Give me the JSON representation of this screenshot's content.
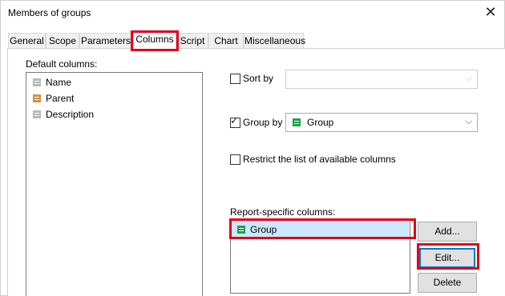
{
  "window": {
    "title": "Members of groups",
    "close_glyph": "✕"
  },
  "tabs": [
    {
      "label": "General"
    },
    {
      "label": "Scope"
    },
    {
      "label": "Parameters"
    },
    {
      "label": "Columns",
      "active": true
    },
    {
      "label": "Script"
    },
    {
      "label": "Chart"
    },
    {
      "label": "Miscellaneous"
    }
  ],
  "default_columns": {
    "label": "Default columns:",
    "items": [
      {
        "label": "Name",
        "icon": "field-icon-gray"
      },
      {
        "label": "Parent",
        "icon": "field-icon-tan"
      },
      {
        "label": "Description",
        "icon": "field-icon-gray"
      }
    ]
  },
  "sort_by": {
    "label": "Sort by",
    "checked": false,
    "value": "",
    "enabled": false
  },
  "group_by": {
    "label": "Group by",
    "checked": true,
    "value": "Group",
    "icon": "field-icon-green"
  },
  "restrict": {
    "label": "Restrict the list of available columns",
    "checked": false
  },
  "report_columns": {
    "label": "Report-specific columns:",
    "items": [
      {
        "label": "Group",
        "icon": "field-icon-green",
        "selected": true
      }
    ]
  },
  "buttons": {
    "add": "Add...",
    "edit": "Edit...",
    "delete": "Delete"
  },
  "colors": {
    "highlight": "#e0001a",
    "selection": "#cce8ff",
    "focus": "#0078d7"
  }
}
